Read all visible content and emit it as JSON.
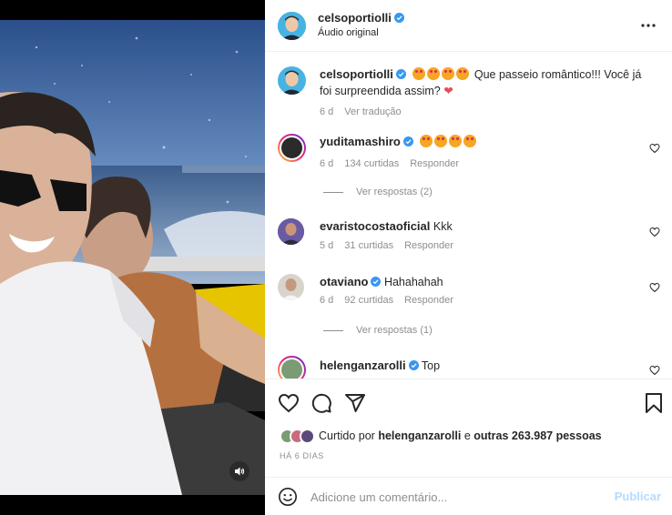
{
  "post": {
    "username": "celsoportiolli",
    "audio_label": "Áudio original"
  },
  "caption": {
    "username": "celsoportiolli",
    "text": "Que passeio romântico!!! Você já foi surpreendida assim?",
    "time": "6 d",
    "translate": "Ver tradução"
  },
  "comments": [
    {
      "username": "yuditamashiro",
      "verified": true,
      "text": "",
      "time": "6 d",
      "likes": "134 curtidas",
      "reply": "Responder",
      "view_replies": "Ver respostas (2)"
    },
    {
      "username": "evaristocostaoficial",
      "verified": false,
      "text": "Kkk",
      "time": "5 d",
      "likes": "31 curtidas",
      "reply": "Responder",
      "view_replies": ""
    },
    {
      "username": "otaviano",
      "verified": true,
      "text": "Hahahahah",
      "time": "6 d",
      "likes": "92 curtidas",
      "reply": "Responder",
      "view_replies": "Ver respostas (1)"
    },
    {
      "username": "helenganzarolli",
      "verified": true,
      "text": "Top",
      "time": "",
      "likes": "",
      "reply": "",
      "view_replies": ""
    }
  ],
  "likes": {
    "prefix": "Curtido por",
    "user": "helenganzarolli",
    "middle": "e",
    "others": "outras 263.987 pessoas"
  },
  "date": "HÁ 6 DIAS",
  "add_comment": {
    "placeholder": "Adicione um comentário...",
    "publish_label": "Publicar"
  },
  "colors": {
    "verified": "#3897f0",
    "muted": "#8e8e8e",
    "publish_disabled": "#b3dbff",
    "heart_red": "#ed4956"
  },
  "icons": [
    "more-icon",
    "heart-icon",
    "comment-icon",
    "share-icon",
    "bookmark-icon",
    "emoji-icon",
    "sound-icon"
  ]
}
